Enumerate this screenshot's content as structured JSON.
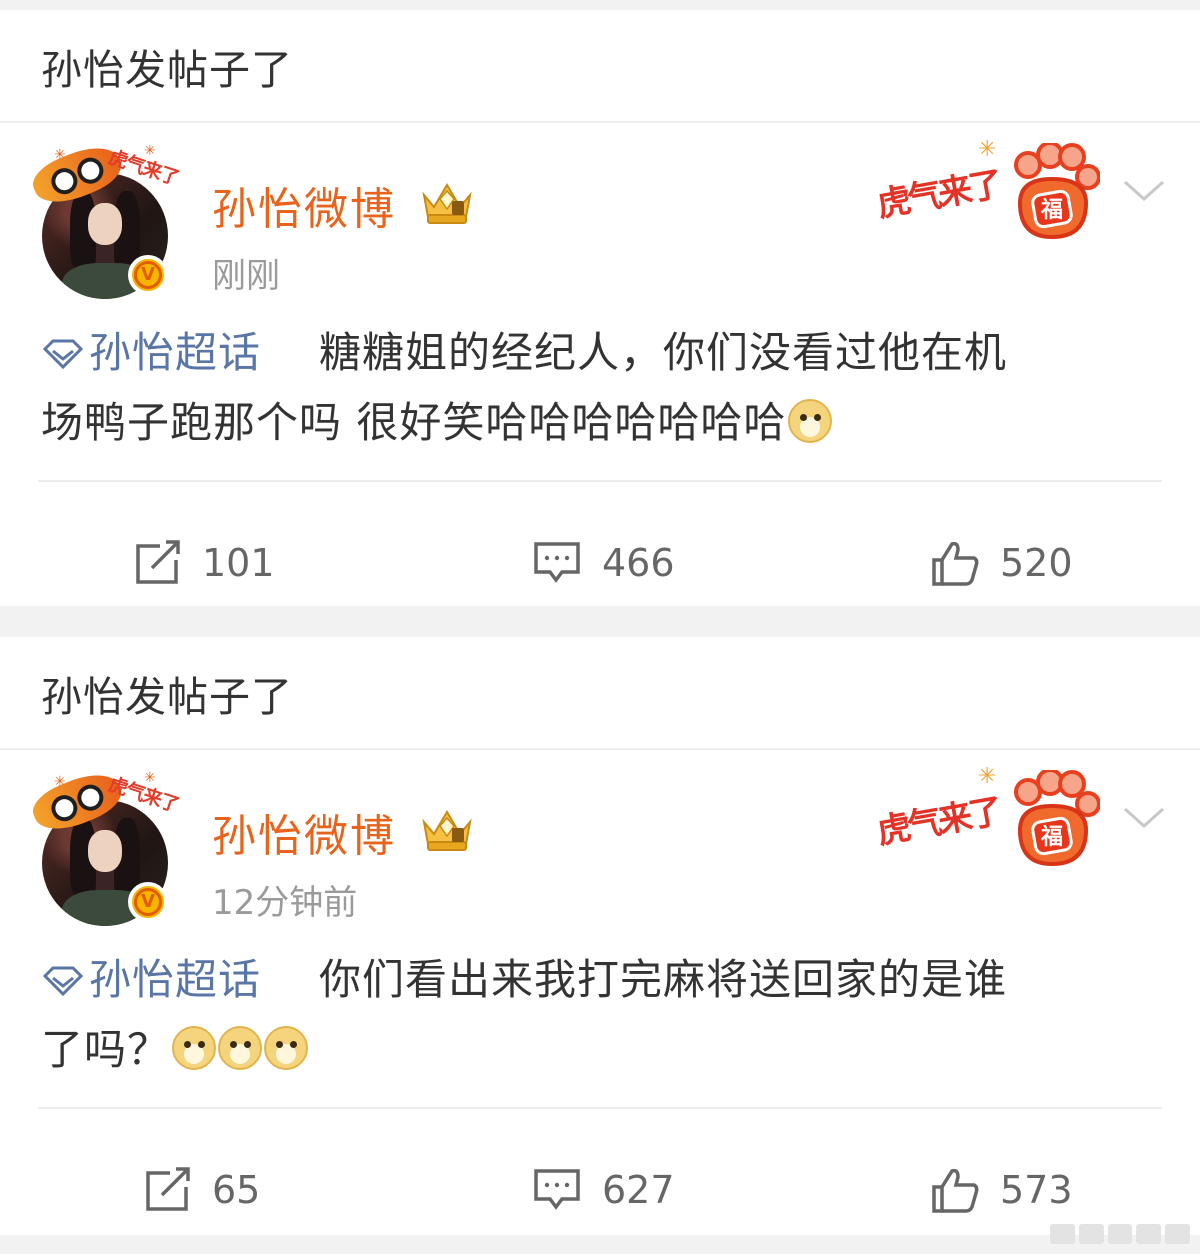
{
  "posts": [
    {
      "section_title": "孙怡发帖子了",
      "user_name": "孙怡微博",
      "avatar_frame_text": "虎气来了",
      "verified_mark": "V",
      "time": "刚刚",
      "promo_text": "虎气来了",
      "promo_badge": "福",
      "topic": "孙怡超话",
      "text_line1": "糖糖姐的经纪人，你们没看过他在机",
      "text_line2": "场鸭子跑那个吗 很好笑哈哈哈哈哈哈哈",
      "emoji_count": 1,
      "reposts": "101",
      "comments": "466",
      "likes": "520"
    },
    {
      "section_title": "孙怡发帖子了",
      "user_name": "孙怡微博",
      "avatar_frame_text": "虎气来了",
      "verified_mark": "V",
      "time": "12分钟前",
      "promo_text": "虎气来了",
      "promo_badge": "福",
      "topic": "孙怡超话",
      "text_line1": "你们看出来我打完麻将送回家的是谁",
      "text_line2": "了吗？",
      "emoji_count": 3,
      "reposts": "65",
      "comments": "627",
      "likes": "573"
    }
  ],
  "colors": {
    "username": "#e8641d",
    "topic": "#5a76a6",
    "text": "#333333",
    "meta": "#9a9a9a",
    "background": "#f2f2f2"
  },
  "icons": [
    "tiger-avatar-frame",
    "verified-v-icon",
    "crown-member-icon",
    "lucky-paw-icon",
    "chevron-down-icon",
    "super-topic-diamond-icon",
    "doge-emoji",
    "repost-icon",
    "comment-icon",
    "like-icon"
  ]
}
